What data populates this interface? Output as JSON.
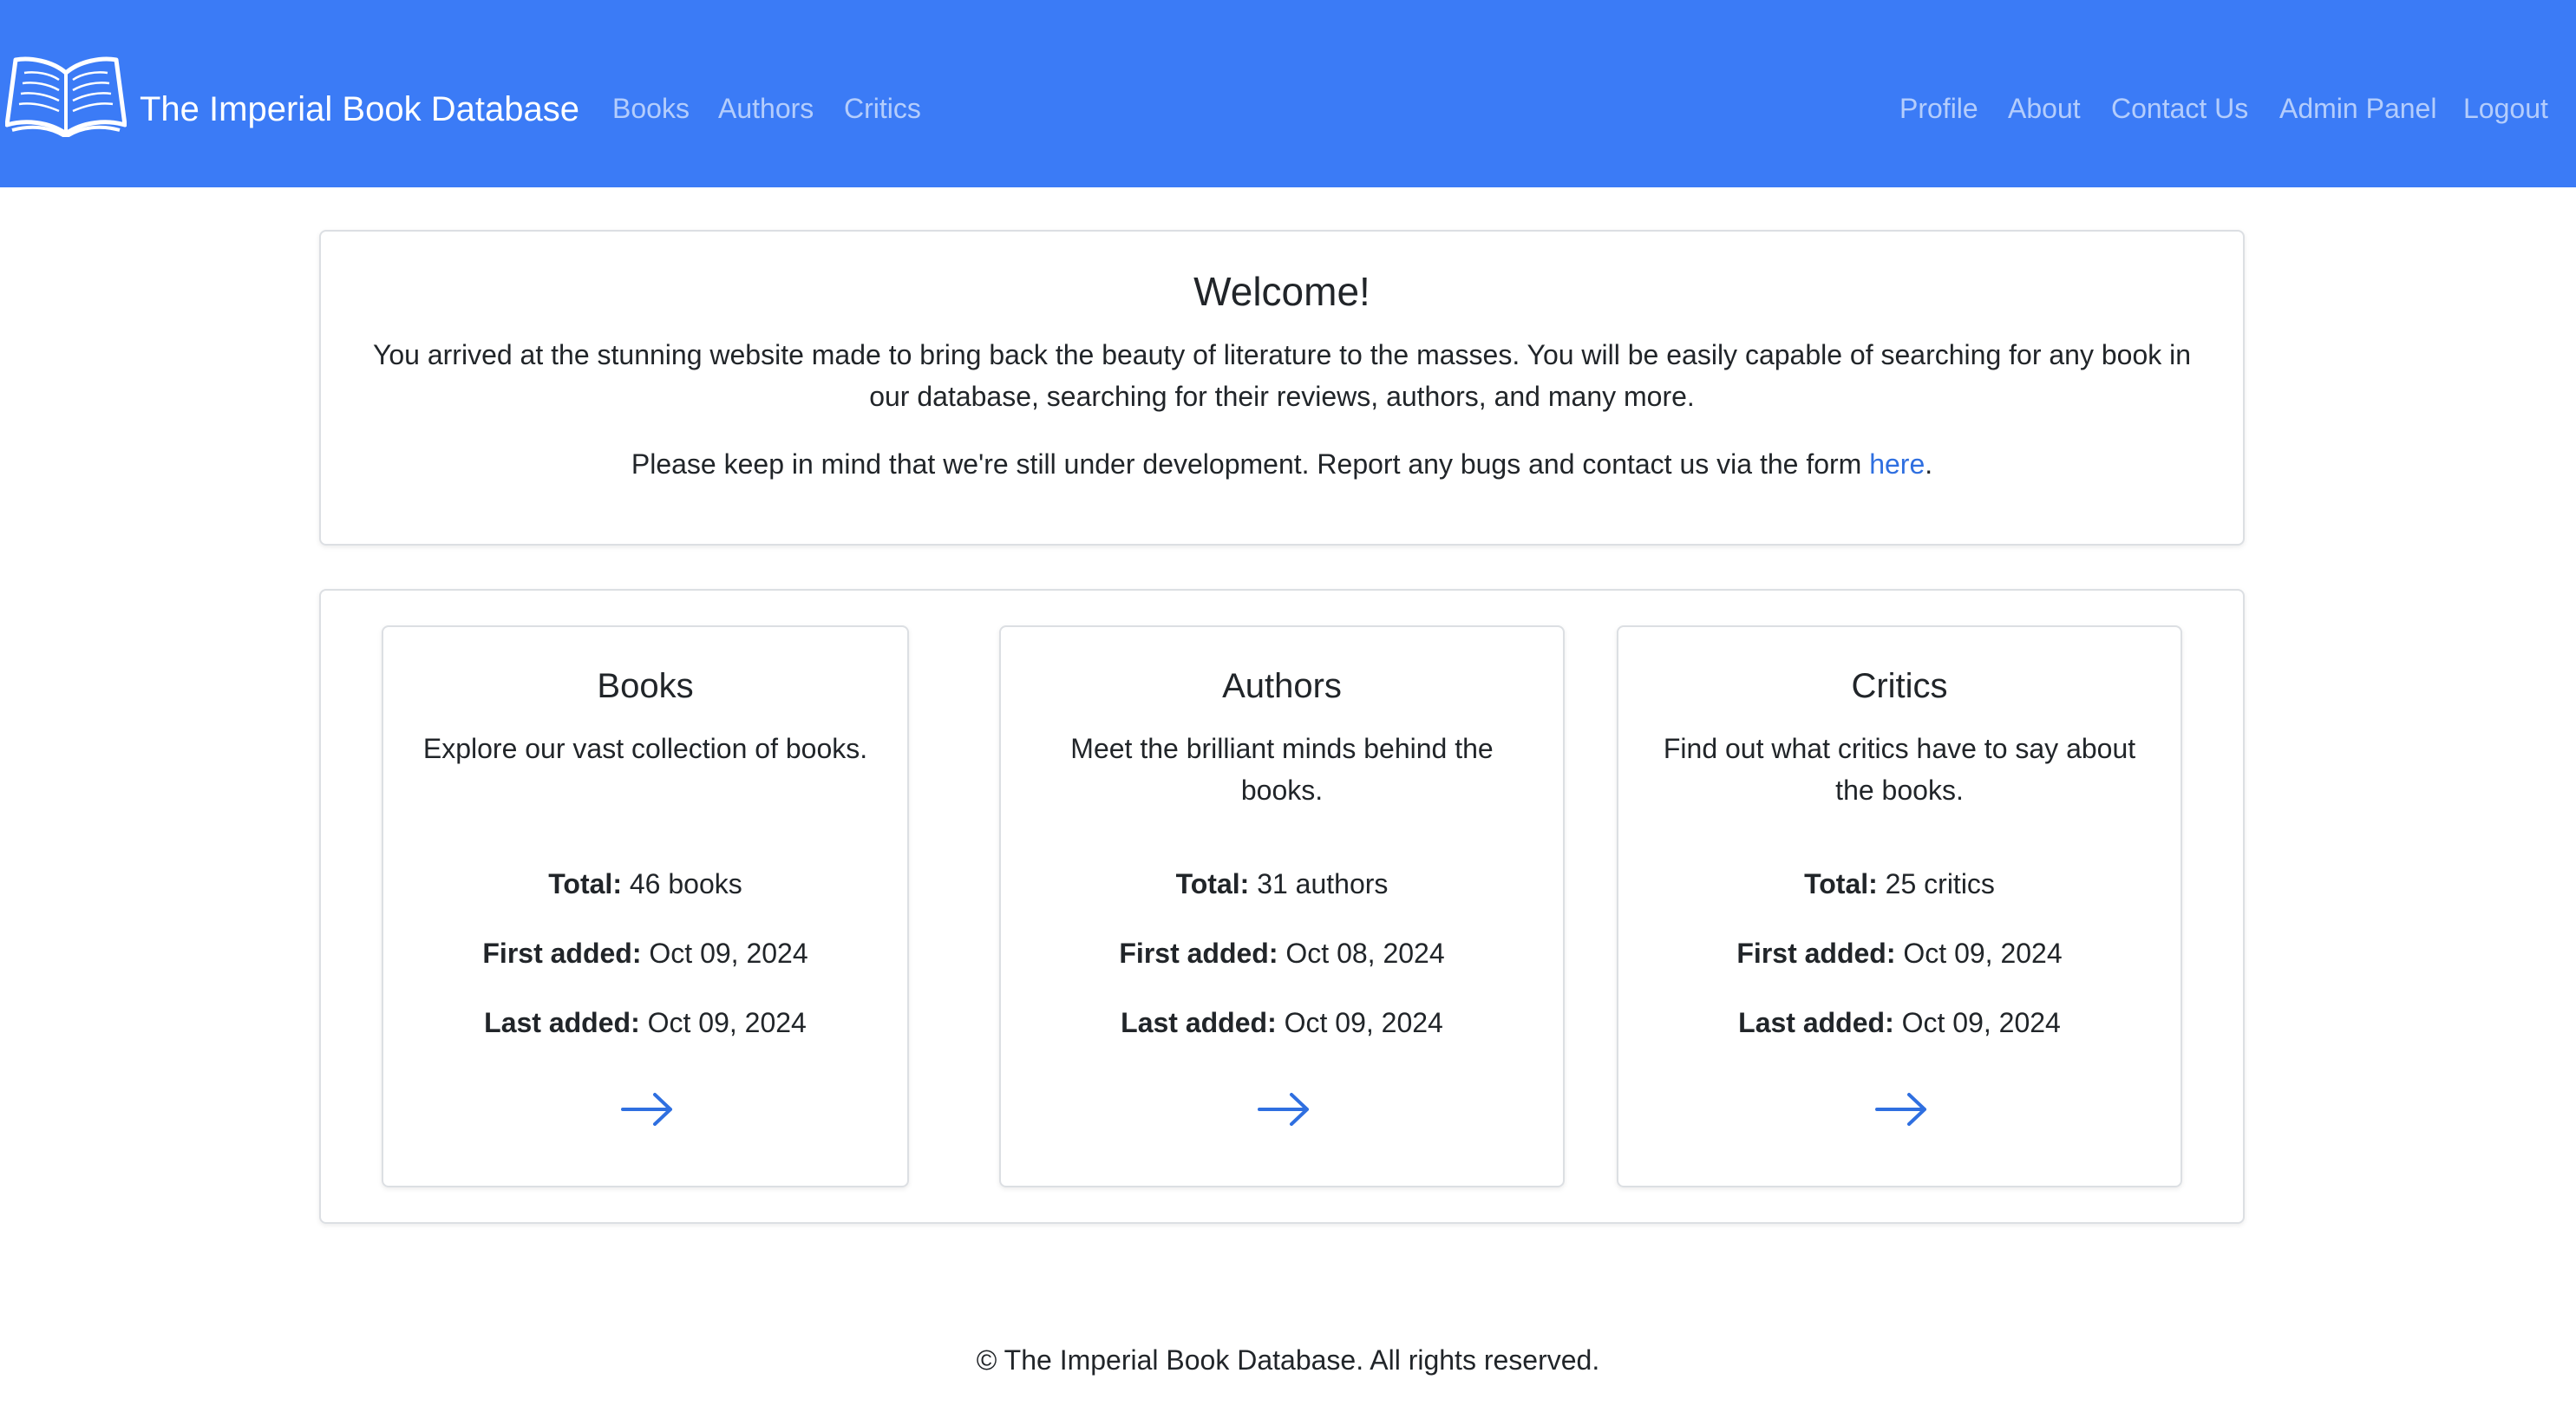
{
  "brand": {
    "name": "The Imperial Book Database",
    "logo_icon": "open-book-icon"
  },
  "nav": {
    "left": [
      "Books",
      "Authors",
      "Critics"
    ],
    "right": [
      "Profile",
      "About",
      "Contact Us",
      "Admin Panel",
      "Logout"
    ]
  },
  "welcome": {
    "title": "Welcome!",
    "paragraph1": "You arrived at the stunning website made to bring back the beauty of literature to the masses. You will be easily capable of searching for any book in our database, searching for their reviews, authors, and many more.",
    "paragraph2_prefix": "Please keep in mind that we're still under development. Report any bugs and contact us via the form ",
    "paragraph2_link": "here",
    "paragraph2_suffix": "."
  },
  "stats": [
    {
      "title": "Books",
      "description": "Explore our vast collection of books.",
      "total_label": "Total:",
      "total_value": "46 books",
      "first_label": "First added:",
      "first_value": "Oct 09, 2024",
      "last_label": "Last added:",
      "last_value": "Oct 09, 2024",
      "arrow_icon": "arrow-right-icon"
    },
    {
      "title": "Authors",
      "description": "Meet the brilliant minds behind the books.",
      "total_label": "Total:",
      "total_value": "31 authors",
      "first_label": "First added:",
      "first_value": "Oct 08, 2024",
      "last_label": "Last added:",
      "last_value": "Oct 09, 2024",
      "arrow_icon": "arrow-right-icon"
    },
    {
      "title": "Critics",
      "description": "Find out what critics have to say about the books.",
      "total_label": "Total:",
      "total_value": "25 critics",
      "first_label": "First added:",
      "first_value": "Oct 09, 2024",
      "last_label": "Last added:",
      "last_value": "Oct 09, 2024",
      "arrow_icon": "arrow-right-icon"
    }
  ],
  "footer": {
    "text": "© The Imperial Book Database. All rights reserved."
  },
  "colors": {
    "navbar": "#3b7bf6",
    "link": "#2f6fe0",
    "text": "#212529",
    "border": "#dcdfe3"
  }
}
